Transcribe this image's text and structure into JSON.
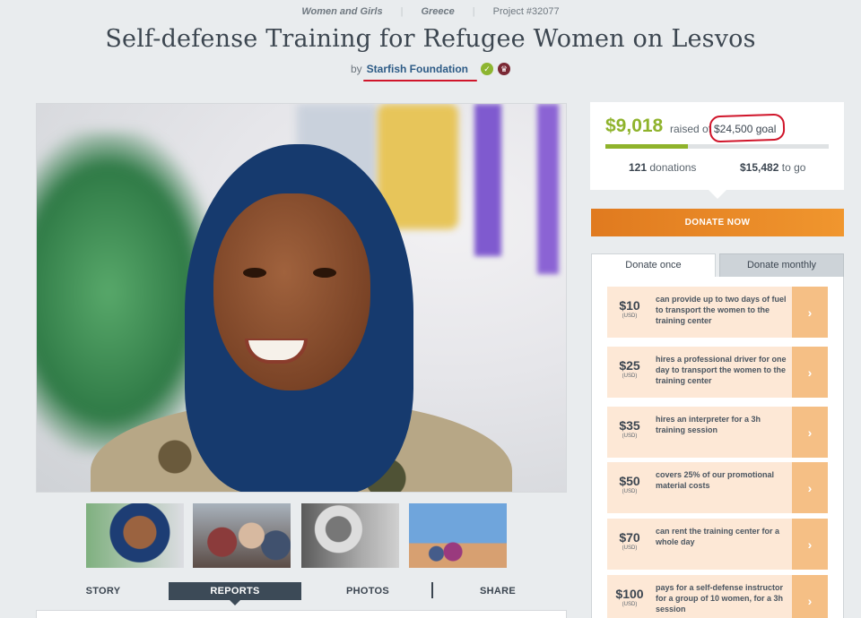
{
  "meta": {
    "category": "Women and Girls",
    "country": "Greece",
    "project": "Project #32077"
  },
  "title": "Self-defense Training for Refugee Women on Lesvos",
  "byline": {
    "prefix": "by",
    "org": "Starfish Foundation",
    "verified_icon": "check-icon",
    "award_icon": "award-icon"
  },
  "tabs": [
    "STORY",
    "REPORTS",
    "PHOTOS",
    "SHARE"
  ],
  "active_tab": "REPORTS",
  "funding": {
    "raised": "$9,018",
    "raised_of": "raised of",
    "goal": "$24,500 goal",
    "progress_fraction": 0.368,
    "donations_count": "121",
    "donations_label": "donations",
    "to_go_amount": "$15,482",
    "to_go_label": "to go"
  },
  "donate_button": "DONATE NOW",
  "donate_tabs": {
    "once": "Donate once",
    "monthly": "Donate monthly"
  },
  "levels": [
    {
      "amount": "$10",
      "currency": "(USD)",
      "desc": "can provide up to two days of fuel to transport the women to the training center"
    },
    {
      "amount": "$25",
      "currency": "(USD)",
      "desc": "hires a professional driver for one day to transport the women to the training center"
    },
    {
      "amount": "$35",
      "currency": "(USD)",
      "desc": "hires an interpreter for a 3h training session"
    },
    {
      "amount": "$50",
      "currency": "(USD)",
      "desc": "covers 25% of our promotional material costs"
    },
    {
      "amount": "$70",
      "currency": "(USD)",
      "desc": "can rent the training center for a whole day"
    },
    {
      "amount": "$100",
      "currency": "(USD)",
      "desc": "pays for a self-defense instructor for a group of 10 women, for a 3h session"
    }
  ],
  "level_arrow": "›",
  "colors": {
    "accent_green": "#8fb32c",
    "donate_orange": "#e8862a",
    "annotation_red": "#d0152a",
    "tab_dark": "#3c4a57"
  }
}
